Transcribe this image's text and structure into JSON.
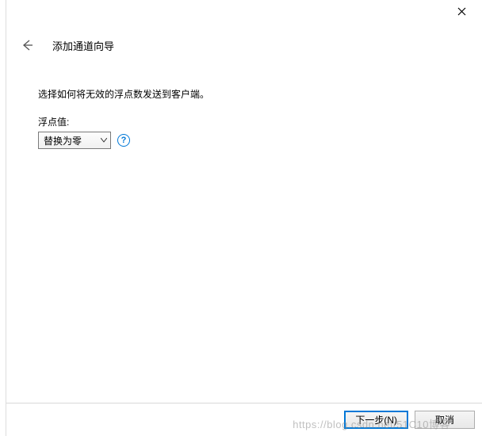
{
  "window": {
    "title": "添加通道向导"
  },
  "content": {
    "description": "选择如何将无效的浮点数发送到客户端。",
    "field_label": "浮点值:",
    "select_value": "替换为零"
  },
  "footer": {
    "next_label": "下一步(N)",
    "cancel_label": "取消"
  },
  "watermark": "https://blog.csdn.net/51C10博客"
}
